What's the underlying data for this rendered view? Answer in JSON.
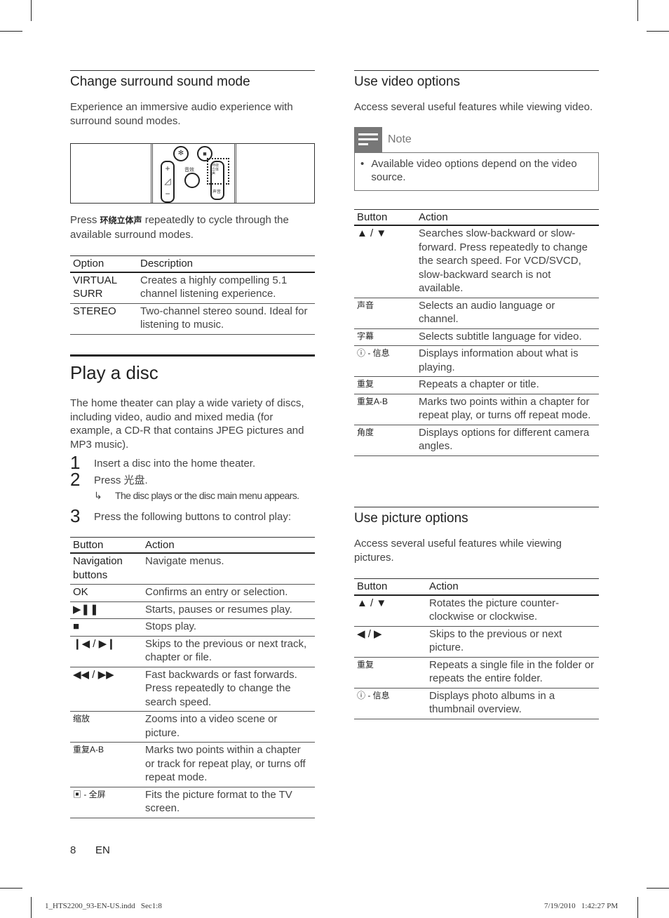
{
  "surround": {
    "title": "Change surround sound mode",
    "desc": "Experience an immersive audio experience with surround sound modes.",
    "press_pre": "Press ",
    "press_key": "环绕立体声",
    "press_post": " repeatedly to cycle through the available surround modes.",
    "remote_labels": {
      "effect": "音效",
      "surround": "环绕立体声",
      "audio": "声音"
    },
    "table": {
      "headers": [
        "Option",
        "Description"
      ],
      "rows": [
        [
          "VIRTUAL SURR",
          "Creates a highly compelling 5.1 channel listening experience."
        ],
        [
          "STEREO",
          "Two-channel stereo sound. Ideal for listening to music."
        ]
      ]
    }
  },
  "play": {
    "title": "Play a disc",
    "desc": "The home theater can play a wide variety of discs, including video, audio and mixed media (for example, a CD-R that contains JPEG pictures and MP3 music).",
    "steps": [
      {
        "n": "1",
        "text": "Insert a disc into the home theater."
      },
      {
        "n": "2",
        "text": "Press 光盘."
      },
      {
        "n": "3",
        "text": "Press the following buttons to control play:"
      }
    ],
    "result": "The disc plays or the disc main menu appears.",
    "table": {
      "headers": [
        "Button",
        "Action"
      ],
      "rows": [
        [
          "Navigation buttons",
          "Navigate menus."
        ],
        [
          "OK",
          "Confirms an entry or selection."
        ],
        [
          "▶❚❚",
          "Starts, pauses or resumes play."
        ],
        [
          "■",
          "Stops play."
        ],
        [
          "❙◀ / ▶❙",
          "Skips to the previous or next track, chapter or file."
        ],
        [
          "◀◀ / ▶▶",
          "Fast backwards or fast forwards. Press repeatedly to change the search speed."
        ],
        [
          "缩放",
          "Zooms into a video scene or picture."
        ],
        [
          "重复A-B",
          "Marks two points within a chapter or track for repeat play, or turns off repeat mode."
        ],
        [
          "▣ - 全屏",
          "Fits the picture format to the TV screen."
        ]
      ]
    }
  },
  "video": {
    "title": "Use video options",
    "desc": "Access several useful features while viewing video.",
    "note_label": "Note",
    "note": "Available video options depend on the video source.",
    "table": {
      "headers": [
        "Button",
        "Action"
      ],
      "rows": [
        [
          "▲ / ▼",
          "Searches slow-backward or slow-forward. Press repeatedly to change the search speed. For VCD/SVCD, slow-backward search is not available."
        ],
        [
          "声音",
          "Selects an audio language or channel."
        ],
        [
          "字幕",
          "Selects subtitle language for video."
        ],
        [
          "ⓘ - 信息",
          "Displays information about what is playing."
        ],
        [
          "重复",
          "Repeats a chapter or title."
        ],
        [
          "重复A-B",
          "Marks two points within a chapter for repeat play, or turns off repeat mode."
        ],
        [
          "角度",
          "Displays options for different camera angles."
        ]
      ]
    }
  },
  "picture": {
    "title": "Use picture options",
    "desc": "Access several useful features while viewing pictures.",
    "table": {
      "headers": [
        "Button",
        "Action"
      ],
      "rows": [
        [
          "▲ / ▼",
          "Rotates the picture counter-clockwise or clockwise."
        ],
        [
          "◀ / ▶",
          "Skips to the previous or next picture."
        ],
        [
          "重复",
          "Repeats a single file in the folder or repeats the entire folder."
        ],
        [
          "ⓘ - 信息",
          "Displays photo albums in a thumbnail overview."
        ]
      ]
    }
  },
  "footer": {
    "page": "8",
    "lang": "EN",
    "file": "1_HTS2200_93-EN-US.indd   Sec1:8",
    "date": "7/19/2010   1:42:27 PM"
  }
}
